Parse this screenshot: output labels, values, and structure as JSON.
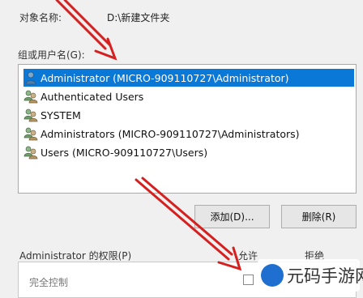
{
  "object": {
    "label": "对象名称:",
    "value": "D:\\新建文件夹"
  },
  "group_label": "组或用户名(G):",
  "users": [
    {
      "name": "Administrator (MICRO-909110727\\Administrator)",
      "icon": "user-icon",
      "selected": true
    },
    {
      "name": "Authenticated Users",
      "icon": "users-group-icon",
      "selected": false
    },
    {
      "name": "SYSTEM",
      "icon": "users-group-icon",
      "selected": false
    },
    {
      "name": "Administrators (MICRO-909110727\\Administrators)",
      "icon": "users-group-icon",
      "selected": false
    },
    {
      "name": "Users (MICRO-909110727\\Users)",
      "icon": "users-group-icon",
      "selected": false
    }
  ],
  "buttons": {
    "add": "添加(D)...",
    "remove": "删除(R)"
  },
  "permissions": {
    "label": "Administrator 的权限(P)",
    "allow": "允许",
    "deny": "拒绝",
    "rows": [
      {
        "name": "完全控制",
        "allow_checked": false
      }
    ]
  },
  "watermark": "元码手游网",
  "colors": {
    "selection": "#0a78d7",
    "arrow": "#d62020",
    "window_bg": "#f0f0f0"
  }
}
